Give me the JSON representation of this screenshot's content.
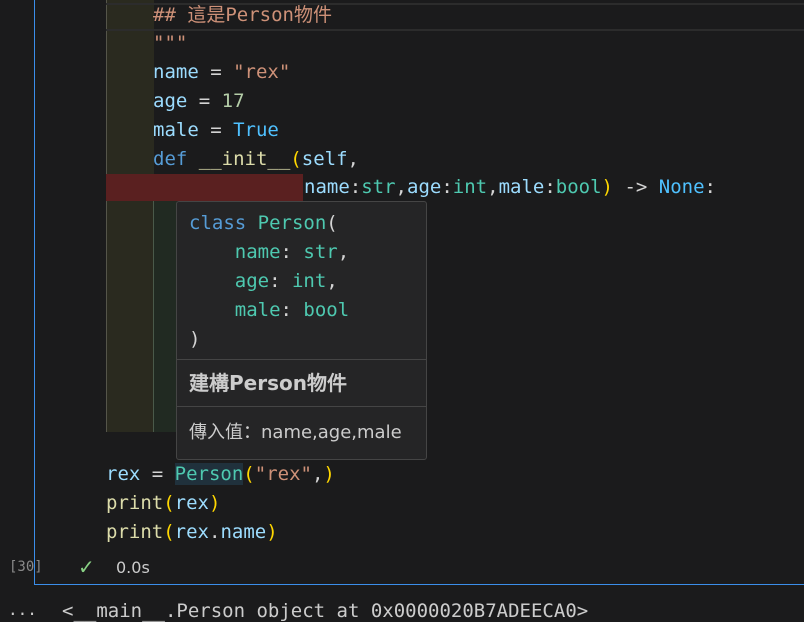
{
  "code_lines": {
    "l1": "## 這是Person物件",
    "l2": "\"\"\"",
    "l3_var": "name",
    "l3_op": " = ",
    "l3_val": "\"rex\"",
    "l4_var": "age",
    "l4_op": " = ",
    "l4_val": "17",
    "l5_var": "male",
    "l5_op": " = ",
    "l5_val": "True",
    "l6_kw": "def",
    "l6_fn": "__init__",
    "l6_paren": "(",
    "l6_self": "self",
    "l6_comma": ",",
    "l7_p1": "name",
    "l7_t1": "str",
    "l7_p2": "age",
    "l7_t2": "int",
    "l7_p3": "male",
    "l7_t3": "bool",
    "l7_paren": ")",
    "l7_arrow": " -> ",
    "l7_ret": "None",
    "l7_colon": ":",
    "l8_var": "rex",
    "l8_op": " = ",
    "l8_cls": "Person",
    "l8_open": "(",
    "l8_arg": "\"rex\"",
    "l8_comma": ",",
    "l8_close": ")",
    "l9_fn": "print",
    "l9_arg": "rex",
    "l10_fn": "print",
    "l10_arg1": "rex",
    "l10_arg2": "name"
  },
  "tooltip": {
    "sig_kw": "class",
    "sig_cls": "Person",
    "p1": "name",
    "t1": "str",
    "p2": "age",
    "t2": "int",
    "p3": "male",
    "t3": "bool",
    "title": "建構Person物件",
    "description": "傳入值：name,age,male"
  },
  "cell_status": {
    "execution_count": "[30]",
    "duration": "0.0s",
    "status_icon": "check-icon"
  },
  "output": {
    "more": "...",
    "text": "<__main__.Person object at 0x0000020B7ADEECA0>"
  },
  "colors": {
    "accent": "#3b8eea",
    "success": "#89d185",
    "error_bg": "#5a2020"
  }
}
